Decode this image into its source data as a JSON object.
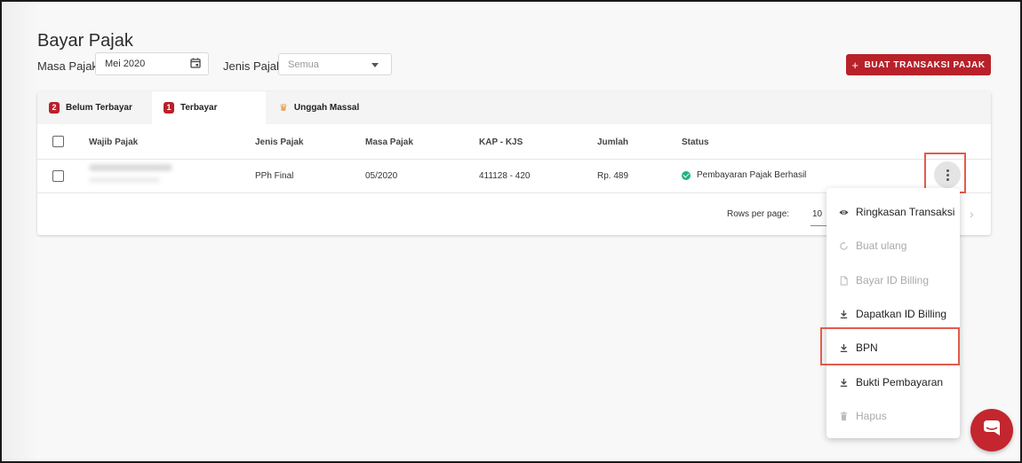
{
  "page": {
    "title": "Bayar Pajak"
  },
  "filters": {
    "masa_label": "Masa Pajak",
    "masa_value": "Mei 2020",
    "jenis_label": "Jenis Pajak",
    "jenis_value": "Semua"
  },
  "toolbar": {
    "create_label": "BUAT TRANSAKSI PAJAK",
    "create_icon": "+"
  },
  "tabs": [
    {
      "label": "Belum Terbayar",
      "count": "2",
      "active": false
    },
    {
      "label": "Terbayar",
      "count": "1",
      "active": true
    },
    {
      "label": "Unggah Massal",
      "icon": "crown-icon",
      "active": false
    }
  ],
  "table": {
    "columns": [
      "Wajib Pajak",
      "Jenis Pajak",
      "Masa Pajak",
      "KAP - KJS",
      "Jumlah",
      "Status"
    ],
    "rows": [
      {
        "jenis": "PPh Final",
        "masa": "05/2020",
        "kap": "411128 - 420",
        "jumlah": "Rp. 489",
        "status": "Pembayaran Pajak Berhasil"
      }
    ]
  },
  "pagination": {
    "rows_label": "Rows per page:",
    "rows_value": "10"
  },
  "menu": {
    "items": [
      {
        "label": "Ringkasan Transaksi",
        "icon": "eye-icon",
        "enabled": true
      },
      {
        "label": "Buat ulang",
        "icon": "refresh-icon",
        "enabled": false
      },
      {
        "label": "Bayar ID Billing",
        "icon": "file-icon",
        "enabled": false
      },
      {
        "label": "Dapatkan ID Billing",
        "icon": "download-icon",
        "enabled": true
      },
      {
        "label": "BPN",
        "icon": "download-icon",
        "enabled": true
      },
      {
        "label": "Bukti Pembayaran",
        "icon": "download-icon",
        "enabled": true
      },
      {
        "label": "Hapus",
        "icon": "trash-icon",
        "enabled": false
      }
    ]
  },
  "colors": {
    "brand": "#b8212a",
    "success": "#20b47a",
    "highlight": "#e25b4d"
  }
}
